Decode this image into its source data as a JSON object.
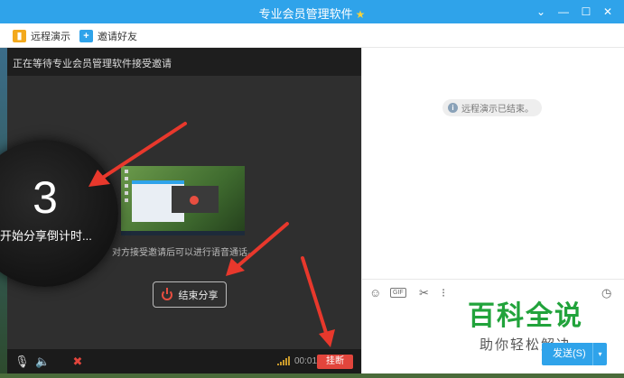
{
  "window": {
    "title": "专业会员管理软件",
    "star": "★",
    "minimize": "—",
    "dropdown": "⌄",
    "maximize": "☐",
    "close": "✕"
  },
  "toolbar": {
    "remote_demo": "远程演示",
    "invite_friend": "邀请好友"
  },
  "share_panel": {
    "header": "正在等待专业会员管理软件接受邀请",
    "countdown_number": "3",
    "countdown_label": "开始分享倒计时...",
    "hint": "对方接受邀请后可以进行语音通话。",
    "stop_share": "结束分享",
    "timer": "00:01",
    "hang_up": "挂断"
  },
  "chat_panel": {
    "notice": "远程演示已结束。",
    "send": "发送(S)",
    "watermark_title": "百科全说",
    "watermark_sub": "助你轻松解决"
  },
  "colors": {
    "titlebar": "#2fa3ea",
    "hangup": "#e2453c",
    "watermark": "#21a33b"
  }
}
